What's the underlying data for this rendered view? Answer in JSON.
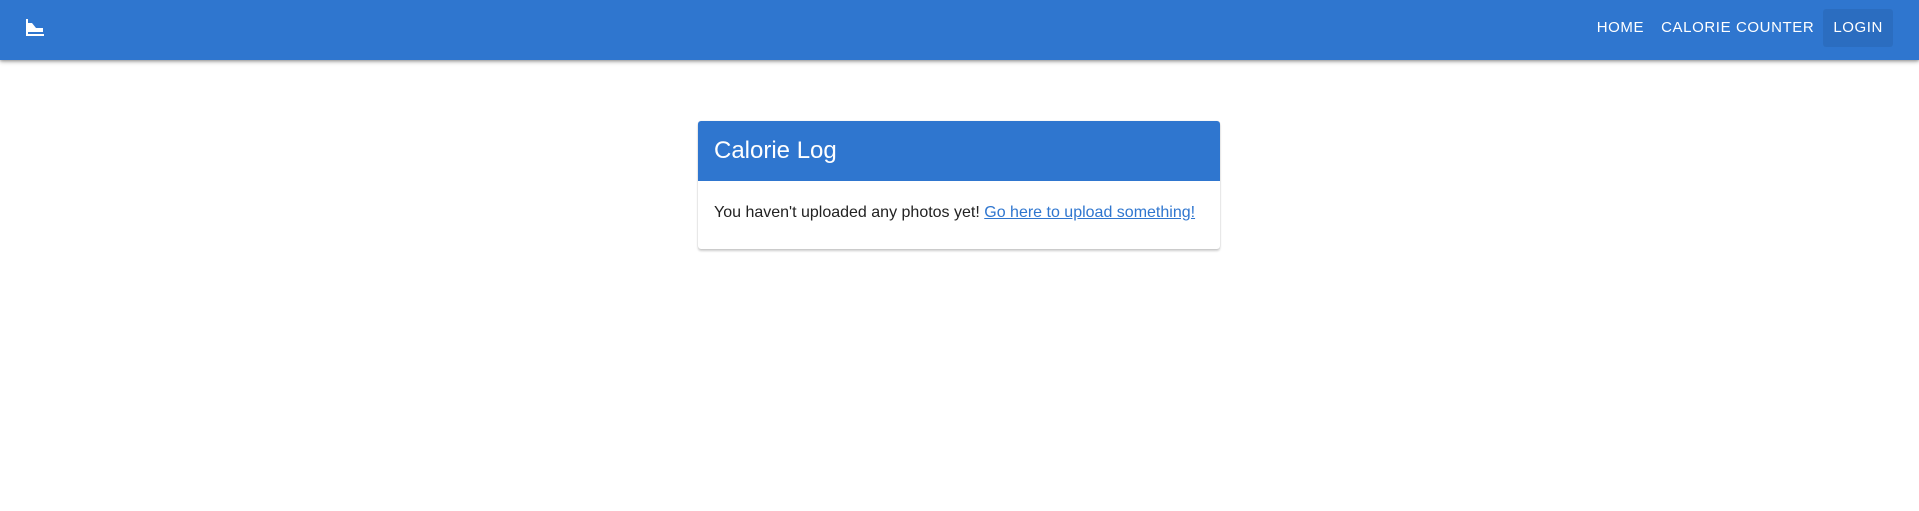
{
  "header": {
    "logo_icon": "flag-icon",
    "nav": [
      {
        "label": "HOME"
      },
      {
        "label": "CALORIE COUNTER"
      },
      {
        "label": "LOGIN"
      }
    ]
  },
  "card": {
    "title": "Calorie Log",
    "message": "You haven't uploaded any photos yet!",
    "link_text": "Go here to upload something!"
  },
  "colors": {
    "primary": "#2f76cf",
    "text": "#222222",
    "background": "#ffffff"
  }
}
